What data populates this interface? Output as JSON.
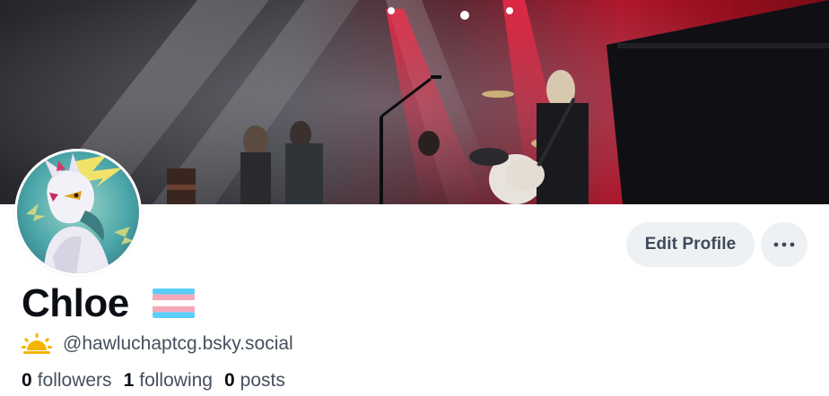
{
  "profile": {
    "display_name": "Chloe",
    "handle": "@hawluchaptcg.bsky.social",
    "name_badge_icon": "transgender-flag-icon",
    "handle_prefix_icon": "sunrise-icon"
  },
  "stats": {
    "followers_count": "0",
    "followers_label": "followers",
    "following_count": "1",
    "following_label": "following",
    "posts_count": "0",
    "posts_label": "posts"
  },
  "actions": {
    "edit_profile_label": "Edit Profile",
    "more_icon": "ellipsis-icon"
  },
  "colors": {
    "button_bg": "#eef1f4",
    "button_text": "#3d4a5a",
    "name_text": "#0b0f14",
    "secondary_text": "#45505e",
    "flag_blue": "#5bcefa",
    "flag_pink": "#f5a9b8",
    "flag_white": "#ffffff",
    "sun_yellow": "#f4b400"
  }
}
